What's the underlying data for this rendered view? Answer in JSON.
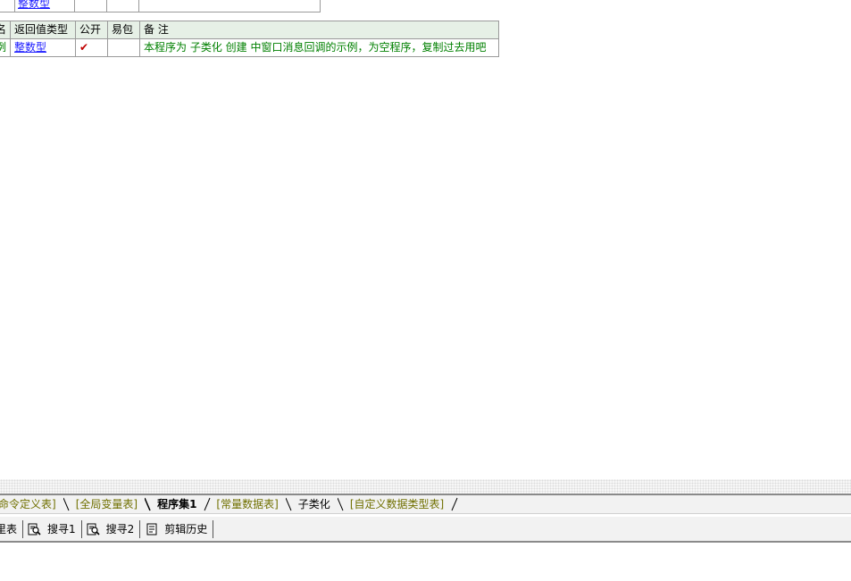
{
  "top_table": {
    "row": {
      "col1": "",
      "type": "整数型",
      "c3": "",
      "c4": "",
      "c5": ""
    }
  },
  "main_table": {
    "headers": [
      "名",
      "返回值类型",
      "公开",
      "易包",
      "备 注"
    ],
    "row": {
      "name": "例",
      "return_type": "整数型",
      "public_check": "✔",
      "easy_pack": "",
      "remark": "本程序为 子类化 创建 中窗口消息回调的示例，为空程序，复制过去用吧"
    }
  },
  "tabs": [
    {
      "label": "命令定义表]",
      "state": "normal"
    },
    {
      "label": "[全局变量表]",
      "state": "normal"
    },
    {
      "label": "程序集1",
      "state": "active"
    },
    {
      "label": "[常量数据表]",
      "state": "normal"
    },
    {
      "label": "子类化",
      "state": "plain"
    },
    {
      "label": "[自定义数据类型表]",
      "state": "normal"
    }
  ],
  "toolbar": {
    "items": [
      {
        "label": "里表",
        "icon": "none"
      },
      {
        "label": "搜寻1",
        "icon": "search-doc-icon"
      },
      {
        "label": "搜寻2",
        "icon": "search-doc-icon"
      },
      {
        "label": "剪辑历史",
        "icon": "clipboard-doc-icon"
      }
    ]
  },
  "colors": {
    "link": "#1a1aff",
    "remark": "#008000",
    "check": "#c00000",
    "tab_text": "#707000",
    "header_bg": "#e6f0e6"
  }
}
